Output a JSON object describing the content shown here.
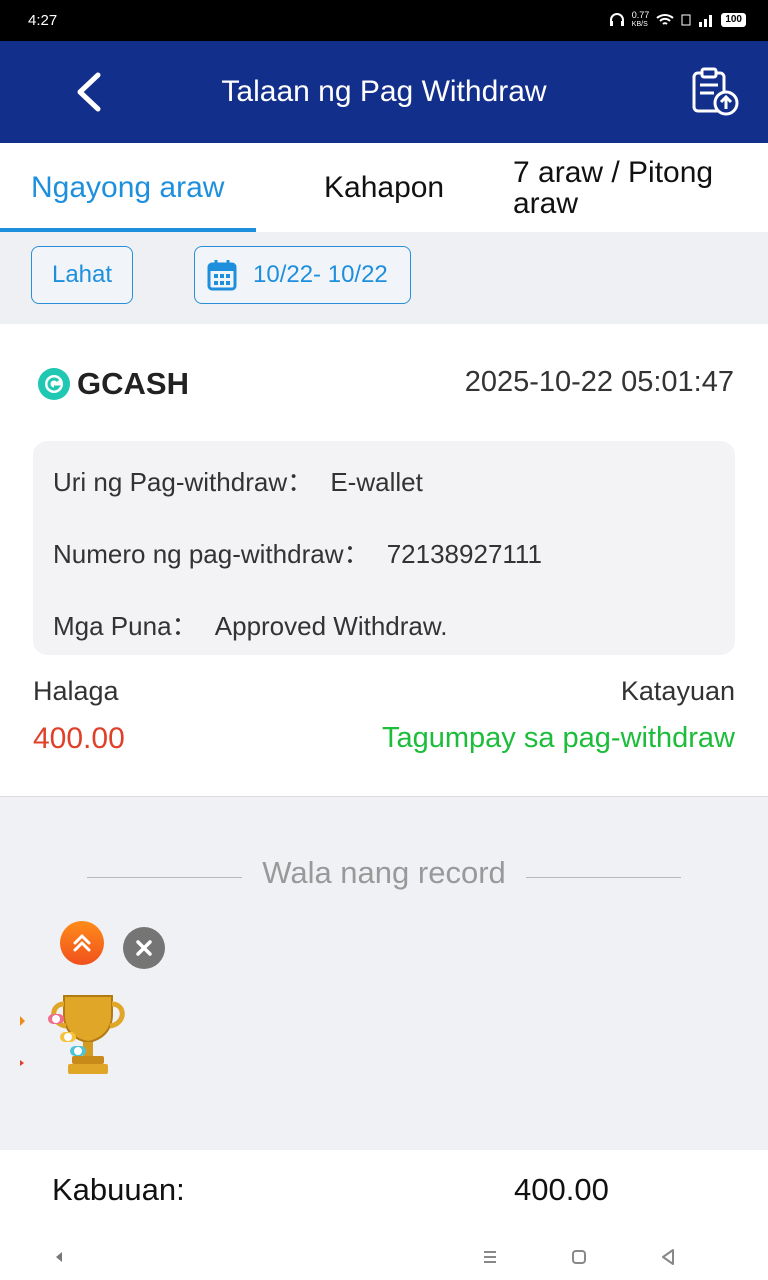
{
  "status_bar": {
    "time": "4:27",
    "net_speed": "0.77",
    "net_unit": "KB/S",
    "battery": "100"
  },
  "header": {
    "title": "Talaan ng Pag Withdraw"
  },
  "tabs": [
    {
      "label": "Ngayong araw",
      "active": true
    },
    {
      "label": "Kahapon",
      "active": false
    },
    {
      "label": "7 araw / Pitong araw",
      "active": false
    }
  ],
  "filters": {
    "all_label": "Lahat",
    "date_range": "10/22- 10/22"
  },
  "record": {
    "method": "GCASH",
    "datetime": "2025-10-22 05:01:47",
    "details": [
      {
        "label": "Uri ng Pag-withdraw：",
        "value": "E-wallet"
      },
      {
        "label": "Numero ng pag-withdraw：",
        "value": "72138927111"
      },
      {
        "label": "Mga Puna：",
        "value": "Approved Withdraw."
      }
    ],
    "amount_label": "Halaga",
    "amount": "400.00",
    "status_label": "Katayuan",
    "status": "Tagumpay sa pag-withdraw",
    "amount_color": "#e0402a",
    "status_color": "#1bbd3a"
  },
  "no_record_text": "Wala nang record",
  "footer": {
    "total_label": "Kabuuan:",
    "total_value": "400.00"
  },
  "colors": {
    "header_bg": "#132f8c",
    "accent": "#1e8fdc"
  }
}
